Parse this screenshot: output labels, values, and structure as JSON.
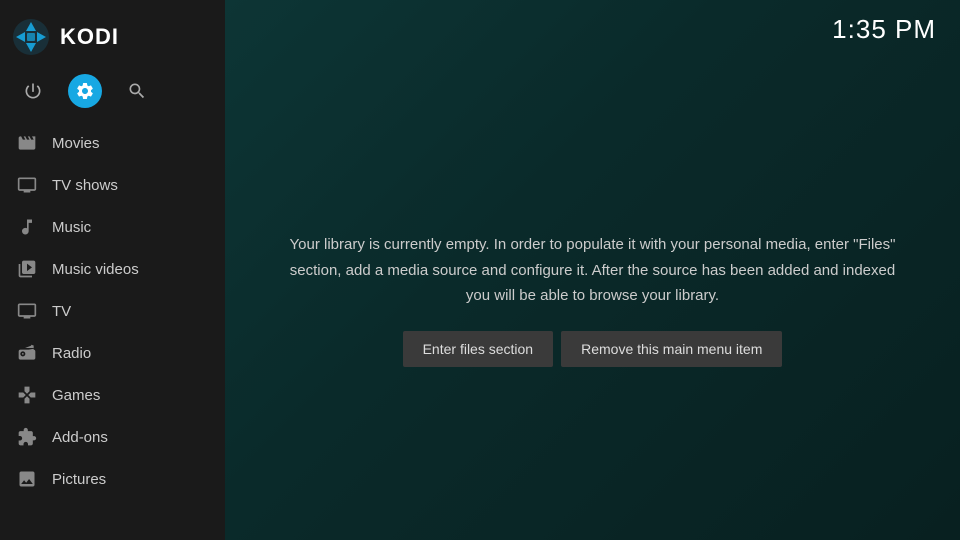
{
  "header": {
    "app_name": "KODI",
    "time": "1:35 PM"
  },
  "sidebar": {
    "icons": [
      {
        "name": "power-icon",
        "symbol": "⏻",
        "active": false
      },
      {
        "name": "settings-icon",
        "symbol": "⚙",
        "active": true
      },
      {
        "name": "search-icon",
        "symbol": "🔍",
        "active": false
      }
    ],
    "menu_items": [
      {
        "id": "movies",
        "label": "Movies",
        "icon": "movies-icon"
      },
      {
        "id": "tv-shows",
        "label": "TV shows",
        "icon": "tv-icon"
      },
      {
        "id": "music",
        "label": "Music",
        "icon": "music-icon"
      },
      {
        "id": "music-videos",
        "label": "Music videos",
        "icon": "music-videos-icon"
      },
      {
        "id": "tv",
        "label": "TV",
        "icon": "live-tv-icon"
      },
      {
        "id": "radio",
        "label": "Radio",
        "icon": "radio-icon"
      },
      {
        "id": "games",
        "label": "Games",
        "icon": "games-icon"
      },
      {
        "id": "add-ons",
        "label": "Add-ons",
        "icon": "addons-icon"
      },
      {
        "id": "pictures",
        "label": "Pictures",
        "icon": "pictures-icon"
      }
    ]
  },
  "main": {
    "library_message": "Your library is currently empty. In order to populate it with your personal media, enter \"Files\" section, add a media source and configure it. After the source has been added and indexed you will be able to browse your library.",
    "enter_files_button": "Enter files section",
    "remove_menu_button": "Remove this main menu item"
  }
}
